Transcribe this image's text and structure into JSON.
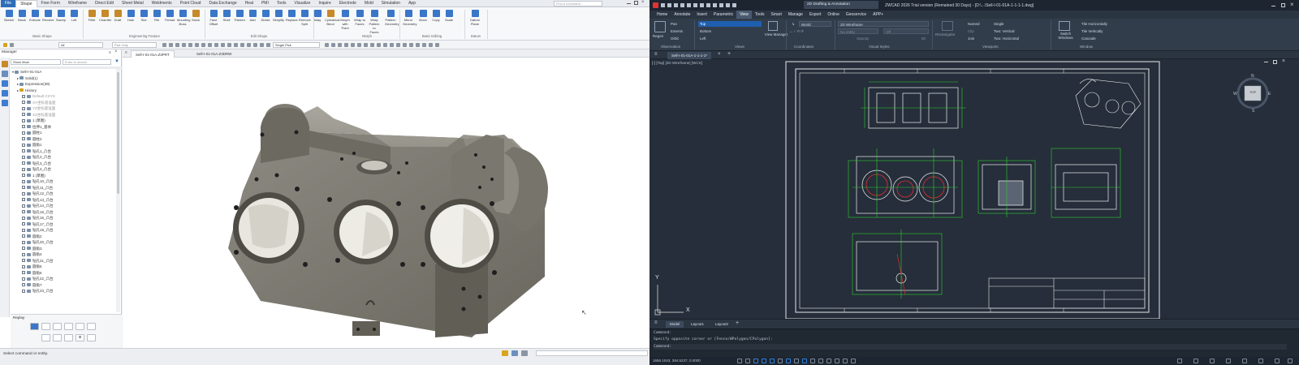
{
  "left": {
    "menus": [
      "File",
      "Shape",
      "Free Form",
      "Wireframe",
      "Direct Edit",
      "Sheet Metal",
      "Weldments",
      "Point Cloud",
      "Data Exchange",
      "Heal",
      "PMI",
      "Tools",
      "Visualize",
      "Inquire",
      "Electrode",
      "Mold",
      "Simulation",
      "App"
    ],
    "search_placeholder": "Find a command",
    "ribbon_buttons": [
      "Sketch",
      "Block",
      "Extrude",
      "Revolve",
      "Sweep",
      "Loft",
      "Fillet",
      "Chamfer",
      "Draft",
      "Hole",
      "Slot",
      "Rib",
      "Thread",
      "Mounting Boss",
      "Stock",
      "Face Offset",
      "Shell",
      "Thicken",
      "Add",
      "Divide",
      "Simplify",
      "Replace",
      "Remove Split",
      "Inlay",
      "Cylindrical Bend",
      "Morph with Point",
      "Wrap to Faces",
      "Wrap Pattern to Faces",
      "Pattern Geometry",
      "Mirror Geometry",
      "Move",
      "Copy",
      "Scale",
      "Datum Plane"
    ],
    "ribbon_groups": [
      "Basic Shape",
      "Engineering Feature",
      "Edit Shape",
      "Morph",
      "Basic Editing",
      "Datum"
    ],
    "toolbar": {
      "filter": "All",
      "part_only": "Part Only",
      "pick": "Single Pick"
    },
    "manager": {
      "title": "Manager",
      "show": "Show Most",
      "search_placeholder": "Enter to search",
      "header": "Feature Node",
      "nodes": [
        {
          "label": "Sell-I-01-01A",
          "depth": 0
        },
        {
          "label": "Solid(1)",
          "depth": 1
        },
        {
          "label": "Expression(39)",
          "depth": 1
        },
        {
          "label": "History",
          "depth": 1
        },
        {
          "label": "Default CSYS",
          "depth": 2
        },
        {
          "label": "XY坐标基准面",
          "depth": 2
        },
        {
          "label": "YZ坐标基准面",
          "depth": 2
        },
        {
          "label": "XZ坐标基准面",
          "depth": 2
        },
        {
          "label": "1 (草图)",
          "depth": 2
        },
        {
          "label": "拉伸1_基体",
          "depth": 2
        },
        {
          "label": "圆柱1",
          "depth": 2
        },
        {
          "label": "圆柱2",
          "depth": 2
        },
        {
          "label": "圆角1",
          "depth": 2
        },
        {
          "label": "钻孔1_凸台",
          "depth": 2
        },
        {
          "label": "钻孔2_凸台",
          "depth": 2
        },
        {
          "label": "钻孔3_凸台",
          "depth": 2
        },
        {
          "label": "钻孔4_凸台",
          "depth": 2
        },
        {
          "label": "1 (草图)",
          "depth": 2
        },
        {
          "label": "钻孔10_凸台",
          "depth": 2
        },
        {
          "label": "钻孔11_凸台",
          "depth": 2
        },
        {
          "label": "钻孔12_凸台",
          "depth": 2
        },
        {
          "label": "钻孔13_凸台",
          "depth": 2
        },
        {
          "label": "钻孔14_凸台",
          "depth": 2
        },
        {
          "label": "钻孔15_凸台",
          "depth": 2
        },
        {
          "label": "钻孔16_凸台",
          "depth": 2
        },
        {
          "label": "钻孔17_凸台",
          "depth": 2
        },
        {
          "label": "钻孔18_凸台",
          "depth": 2
        },
        {
          "label": "圆角2",
          "depth": 2
        },
        {
          "label": "钻孔20_凸台",
          "depth": 2
        },
        {
          "label": "圆角3",
          "depth": 2
        },
        {
          "label": "圆角4",
          "depth": 2
        },
        {
          "label": "钻孔21_凸台",
          "depth": 2
        },
        {
          "label": "圆角5",
          "depth": 2
        },
        {
          "label": "圆角6",
          "depth": 2
        },
        {
          "label": "钻孔22_凸台",
          "depth": 2
        },
        {
          "label": "圆角7",
          "depth": 2
        },
        {
          "label": "钻孔23_凸台",
          "depth": 2
        }
      ],
      "replay_label": "Replay"
    },
    "doc_tabs": [
      "Sell-I-01-01A.Z3PRT",
      "Sell-I-01-01A.Z3DRW"
    ],
    "status_text": "Select command or entity."
  },
  "right": {
    "title": "ZWCAD 2026 Trial version (Remained 30 Days) - [D:\\...\\Sell-I-01-01A-1-1-1-1.dwg]",
    "workspace": "2D Drafting & Annotation",
    "menus": [
      "Home",
      "Annotate",
      "Insert",
      "Parametric",
      "View",
      "Tools",
      "Smart",
      "Manage",
      "Export",
      "Online",
      "Geoservice",
      "APP+"
    ],
    "ribbon": {
      "views": [
        "Top",
        "Bottom",
        "Left"
      ],
      "nav": [
        "Pan",
        "Extents",
        "Orbit"
      ],
      "view_manager": "View Manager",
      "coord": "World",
      "visual_style": "2D Wireframe",
      "no_entity": "No entity",
      "off": "Off",
      "opacity": "Opacity",
      "opacity_val": "60",
      "viewports": [
        "Named",
        "Clip",
        "Join",
        "Single",
        "Two: Vertical",
        "Two: Horizontal"
      ],
      "rect": "Rectangular",
      "window": [
        "Tile Horizontally",
        "Tile Vertically",
        "Cascade"
      ],
      "switch": "Switch Windows",
      "region": "Regen",
      "groups": [
        "Observation",
        "Views",
        "Coordinates",
        "Visual Styles",
        "Viewports",
        "Window"
      ]
    },
    "doc_tab": "Sell-I-01-01A-1-1-1-1*",
    "view_label": "[-] [Top] [2D Wireframe] [WCS]",
    "viewcube": {
      "face": "TOP",
      "n": "N",
      "s": "S",
      "e": "E",
      "w": "W"
    },
    "layouts": [
      "Model",
      "Layout1",
      "Layout2"
    ],
    "command_lines": [
      "Command:",
      "Specify opposite corner or [Fence/WPolygon/CPolygon]:",
      "Command:"
    ],
    "coords": "1656.1043, 394.5237, 0.0000",
    "axis": {
      "x": "X",
      "y": "Y"
    },
    "colors": {
      "accent": "#1e5fb0",
      "drawing_green": "#2fd02f",
      "drawing_white": "#f0f0f0",
      "drawing_red": "#e03030"
    }
  }
}
